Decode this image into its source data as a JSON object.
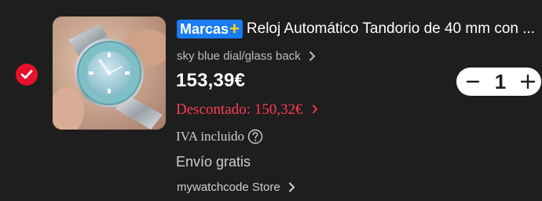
{
  "item": {
    "selected": true,
    "brand_badge": "Marcas",
    "brand_badge_plus": "+",
    "title": "Reloj Automático Tandorio de 40 mm con ...",
    "variant": "sky blue dial/glass back",
    "price": "153,39€",
    "discount_label": "Descontado: 150,32€",
    "vat_label": "IVA incluido",
    "shipping": "Envío gratis",
    "store": "mywatchcode Store",
    "quantity": "1"
  },
  "icons": {
    "checkbox": "check-icon",
    "variant_chevron": "chevron-right-icon",
    "discount_chevron": "chevron-right-icon",
    "vat_help": "question-circle-icon",
    "store_chevron": "chevron-right-icon",
    "minus": "minus-icon",
    "plus": "plus-icon"
  },
  "colors": {
    "background": "#1e1e1e",
    "accent_red": "#e8102d",
    "discount_red": "#ff3a55",
    "brand_blue": "#1a7cf0",
    "brand_plus_yellow": "#ffd21a"
  }
}
